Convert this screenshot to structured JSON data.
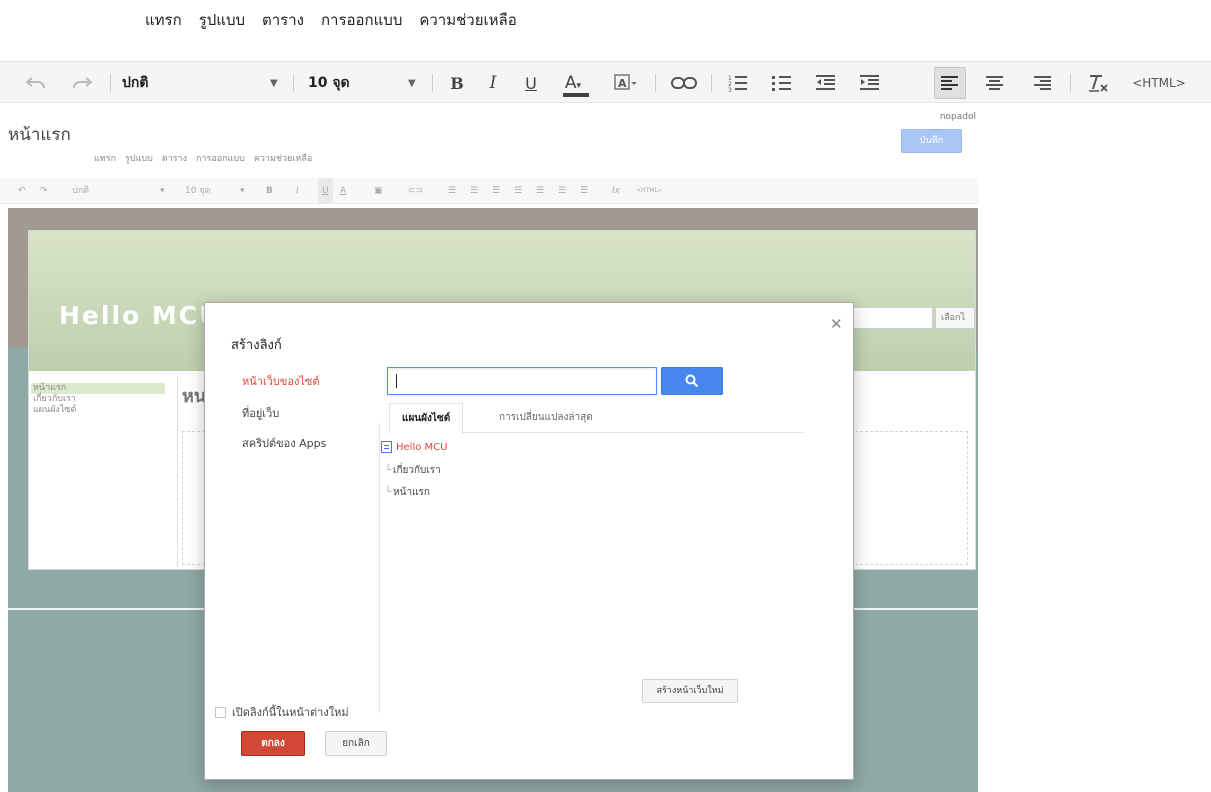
{
  "menu": [
    "แทรก",
    "รูปแบบ",
    "ตาราง",
    "การออกแบบ",
    "ความช่วยเหลือ"
  ],
  "toolbar": {
    "font": "ปกติ",
    "size": "10 จุด",
    "bold": "B",
    "italic": "I",
    "underline": "U",
    "text_color": "A",
    "html": "<HTML>",
    "underline_color": "#444444",
    "active_button": "align-left"
  },
  "page": {
    "title": "หน้าแรก",
    "user": "nopadol",
    "save_label": "บันทึก",
    "small_menu": [
      "แทรก",
      "รูปแบบ",
      "ตาราง",
      "การออกแบบ",
      "ความช่วยเหลือ"
    ],
    "small_toolbar": {
      "font": "ปกติ",
      "size": "10 จุด",
      "html": "<HTML>"
    }
  },
  "site": {
    "title": "Hello MCU",
    "search_button": "เลือกไ",
    "nav": [
      "หน้าแรก",
      "เกี่ยวกับเรา",
      "แผนผังไซต์"
    ],
    "main_title": "หน"
  },
  "dialog": {
    "title": "สร้างลิงก์",
    "left_nav": [
      "หน้าเว็บของไซต์",
      "ที่อยู่เว็บ",
      "สคริปต์ของ Apps"
    ],
    "active_left": 0,
    "search_value": "",
    "tabs": [
      "แผนผังไซต์",
      "การเปลี่ยนแปลงล่าสุด"
    ],
    "tree_root": "Hello MCU",
    "tree_children": [
      "เกี่ยวกับเรา",
      "หน้าแรก"
    ],
    "create_page_label": "สร้างหน้าเว็บใหม่",
    "open_new_window_label": "เปิดลิงก์นี้ในหน้าต่างใหม่",
    "ok_label": "ตกลง",
    "cancel_label": "ยกเลิก",
    "accent_color": "#dd4b39",
    "search_button_color": "#4787ed"
  }
}
